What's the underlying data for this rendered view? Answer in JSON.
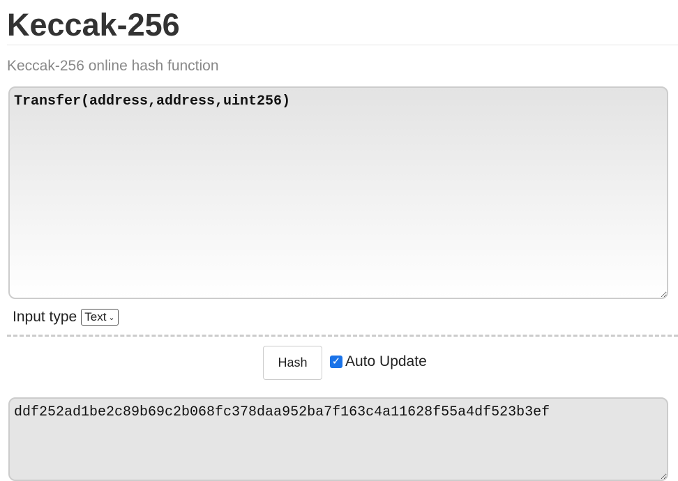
{
  "title": "Keccak-256",
  "subtitle": "Keccak-256 online hash function",
  "input_value": "Transfer(address,address,uint256)",
  "input_type_label": "Input type",
  "input_type_value": "Text",
  "hash_button": "Hash",
  "auto_update_label": "Auto Update",
  "auto_update_checked": true,
  "output_value": "ddf252ad1be2c89b69c2b068fc378daa952ba7f163c4a11628f55a4df523b3ef",
  "accent": "#1a73e8"
}
